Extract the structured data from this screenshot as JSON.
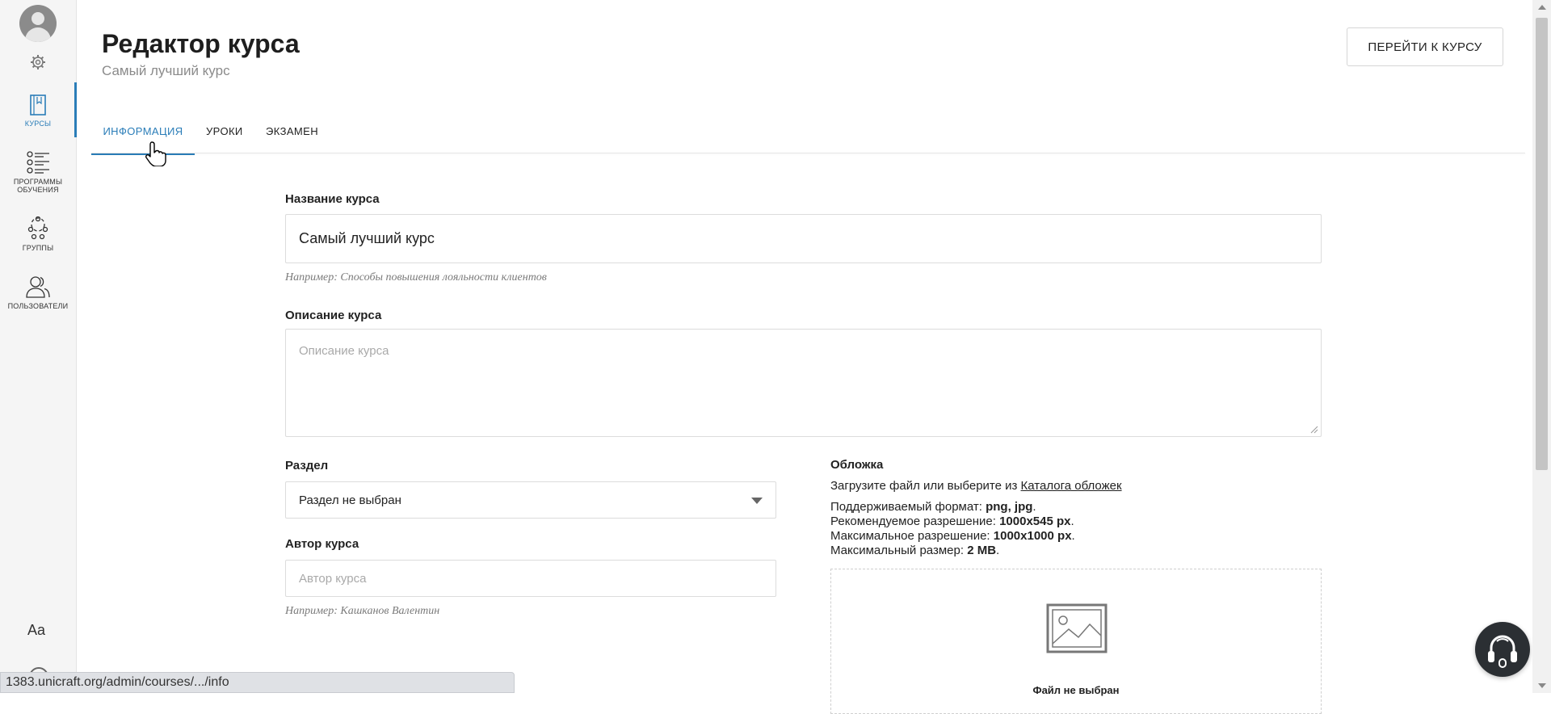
{
  "sidebar": {
    "items": [
      {
        "label": "КУРСЫ",
        "icon": "book-icon",
        "active": true
      },
      {
        "label": "ПРОГРАММЫ ОБУЧЕНИЯ",
        "icon": "checklist-icon",
        "active": false
      },
      {
        "label": "ГРУППЫ",
        "icon": "group-icon",
        "active": false
      },
      {
        "label": "ПОЛЬЗОВАТЕЛИ",
        "icon": "users-icon",
        "active": false
      }
    ],
    "font_settings_label": "Aa",
    "accent_color": "#2a7db8"
  },
  "header": {
    "title": "Редактор курса",
    "subtitle": "Самый лучший курс",
    "goto_button": "ПЕРЕЙТИ К КУРСУ"
  },
  "tabs": [
    {
      "label": "ИНФОРМАЦИЯ",
      "active": true
    },
    {
      "label": "УРОКИ",
      "active": false
    },
    {
      "label": "ЭКЗАМЕН",
      "active": false
    }
  ],
  "form": {
    "name": {
      "label": "Название курса",
      "value": "Самый лучший курс",
      "hint": "Например: Способы повышения лояльности клиентов"
    },
    "description": {
      "label": "Описание курса",
      "placeholder": "Описание курса"
    },
    "section": {
      "label": "Раздел",
      "selected": "Раздел не выбран"
    },
    "author": {
      "label": "Автор курса",
      "placeholder": "Автор курса",
      "hint": "Например: Кашканов Валентин"
    },
    "cover": {
      "label": "Обложка",
      "upload_prefix": "Загрузите файл или выберите из ",
      "catalog_link": "Каталога обложек",
      "format_label": "Поддерживаемый формат: ",
      "format_value": "png, jpg",
      "recommended_label": "Рекомендуемое разрешение: ",
      "recommended_value": "1000x545 px",
      "max_res_label": "Максимальное разрешение: ",
      "max_res_value": "1000x1000 px",
      "max_size_label": "Максимальный размер: ",
      "max_size_value": "2 MB",
      "no_file": "Файл не выбран"
    }
  },
  "statusbar": {
    "url": "1383.unicraft.org/admin/courses/.../info"
  }
}
